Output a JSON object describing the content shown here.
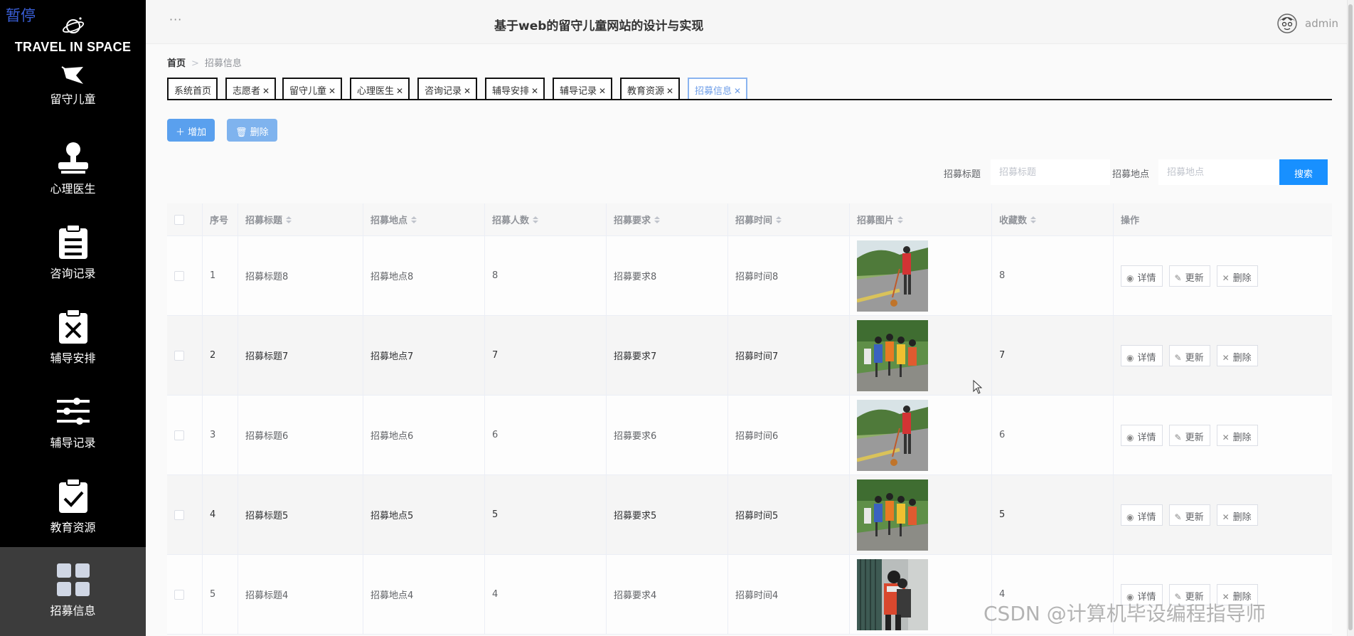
{
  "overlay": {
    "pause_label": "暂停"
  },
  "brand": {
    "name": "TRAVEL IN SPACE"
  },
  "sidebar": {
    "items": [
      {
        "label": "留守儿童",
        "icon": "flag-icon"
      },
      {
        "label": "心理医生",
        "icon": "stamp-icon"
      },
      {
        "label": "咨询记录",
        "icon": "clipboard-list-icon"
      },
      {
        "label": "辅导安排",
        "icon": "clipboard-x-icon"
      },
      {
        "label": "辅导记录",
        "icon": "sliders-icon"
      },
      {
        "label": "教育资源",
        "icon": "clipboard-check-icon"
      },
      {
        "label": "招募信息",
        "icon": "grid-icon",
        "active": true
      }
    ]
  },
  "header": {
    "dots": "···",
    "title": "基于web的留守儿童网站的设计与实现",
    "user": "admin"
  },
  "breadcrumb": {
    "home": "首页",
    "current": "招募信息"
  },
  "tabs": [
    {
      "label": "系统首页",
      "closable": false
    },
    {
      "label": "志愿者",
      "closable": true
    },
    {
      "label": "留守儿童",
      "closable": true
    },
    {
      "label": "心理医生",
      "closable": true
    },
    {
      "label": "咨询记录",
      "closable": true
    },
    {
      "label": "辅导安排",
      "closable": true
    },
    {
      "label": "辅导记录",
      "closable": true
    },
    {
      "label": "教育资源",
      "closable": true
    },
    {
      "label": "招募信息",
      "closable": true,
      "active": true
    }
  ],
  "toolbar": {
    "add_label": "增加",
    "delete_label": "删除"
  },
  "search": {
    "title_label": "招募标题",
    "title_placeholder": "招募标题",
    "place_label": "招募地点",
    "place_placeholder": "招募地点",
    "button_label": "搜索"
  },
  "table": {
    "columns": [
      "序号",
      "招募标题",
      "招募地点",
      "招募人数",
      "招募要求",
      "招募时间",
      "招募图片",
      "收藏数",
      "操作"
    ],
    "actions": {
      "detail": "详情",
      "update": "更新",
      "delete": "删除"
    },
    "rows": [
      {
        "index": "1",
        "title": "招募标题8",
        "place": "招募地点8",
        "count": "8",
        "requirement": "招募要求8",
        "time": "招募时间8",
        "image": "photo-road-girl",
        "favorites": "8"
      },
      {
        "index": "2",
        "title": "招募标题7",
        "place": "招募地点7",
        "count": "7",
        "requirement": "招募要求7",
        "time": "招募时间7",
        "image": "photo-volunteers-group",
        "favorites": "7"
      },
      {
        "index": "3",
        "title": "招募标题6",
        "place": "招募地点6",
        "count": "6",
        "requirement": "招募要求6",
        "time": "招募时间6",
        "image": "photo-road-girl",
        "favorites": "6"
      },
      {
        "index": "4",
        "title": "招募标题5",
        "place": "招募地点5",
        "count": "5",
        "requirement": "招募要求5",
        "time": "招募时间5",
        "image": "photo-volunteers-group",
        "favorites": "5"
      },
      {
        "index": "5",
        "title": "招募标题4",
        "place": "招募地点4",
        "count": "4",
        "requirement": "招募要求4",
        "time": "招募时间4",
        "image": "photo-wall-volunteers",
        "favorites": "4"
      }
    ]
  },
  "watermark": "CSDN @计算机毕设编程指导师"
}
